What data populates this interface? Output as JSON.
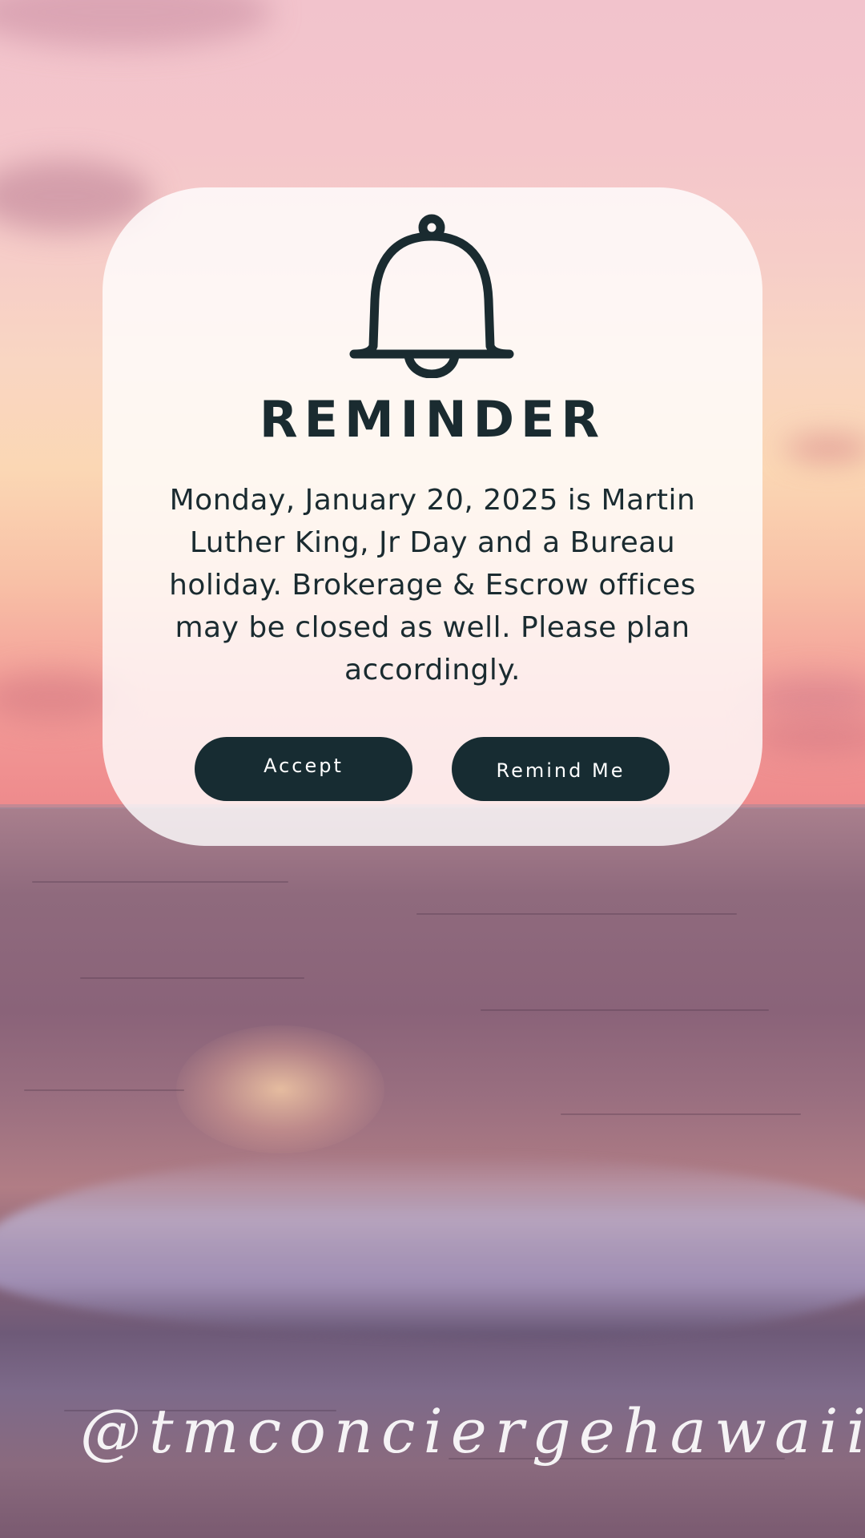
{
  "card": {
    "icon": "bell-icon",
    "title": "REMINDER",
    "message": "Monday, January 20, 2025 is Martin Luther King, Jr Day and a Bureau holiday. Brokerage & Escrow offices may be closed as well. Please plan accordingly.",
    "accept_label": "Accept",
    "remind_label": "Remind Me"
  },
  "watermark": {
    "handle": "@tmconciergehawaii"
  },
  "colors": {
    "text": "#1a2b30",
    "button": "#172c32",
    "button_text": "#ffffff",
    "card_bg": "#ffffff"
  }
}
